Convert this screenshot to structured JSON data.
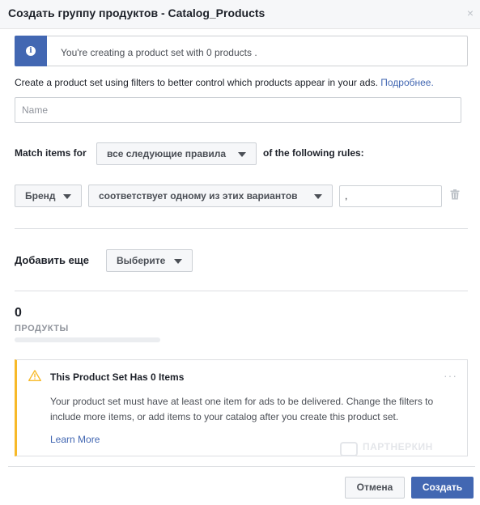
{
  "dialog": {
    "title": "Создать группу продуктов - Catalog_Products",
    "close_label": "×"
  },
  "info_banner": {
    "icon": "info-icon",
    "text": "You're creating a product set with 0 products ."
  },
  "description": {
    "text": "Create a product set using filters to better control which products appear in your ads.",
    "link_label": "Подробнее."
  },
  "name_field": {
    "placeholder": "Name",
    "value": ""
  },
  "match": {
    "prefix_label": "Match items for",
    "selector_value": "все следующие правила",
    "suffix_label": "of the following rules:"
  },
  "rule": {
    "field_value": "Бренд",
    "operator_value": "соответствует одному из этих вариантов",
    "input_value": ","
  },
  "add_more": {
    "label": "Добавить еще",
    "selector_value": "Выберите"
  },
  "product_count": {
    "value": "0",
    "label": "ПРОДУКТЫ",
    "progress_fraction": 0
  },
  "warning": {
    "icon": "warning-icon",
    "title": "This Product Set Has 0 Items",
    "more_label": "···",
    "body": "Your product set must have at least one item for ads to be delivered. Change the filters to include more items, or add items to your catalog after you create this product set.",
    "link_label": "Learn More"
  },
  "watermark": {
    "text": "ПАРТНЕРКИН"
  },
  "buttons": {
    "cancel_label": "Отмена",
    "create_label": "Создать"
  },
  "colors": {
    "accent": "#4267b2",
    "warning": "#f7b928"
  }
}
